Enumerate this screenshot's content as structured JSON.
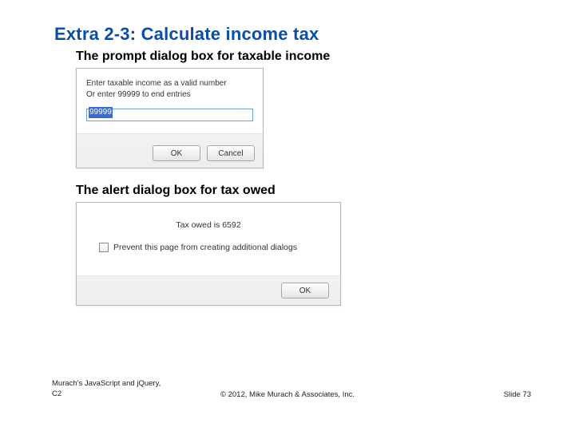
{
  "slide": {
    "title": "Extra 2-3:   Calculate income tax"
  },
  "section1": {
    "heading": "The prompt dialog box for taxable income"
  },
  "prompt": {
    "line1": "Enter taxable income as a valid number",
    "line2": "Or enter 99999 to end entries",
    "input_value": "99999",
    "ok_label": "OK",
    "cancel_label": "Cancel"
  },
  "section2": {
    "heading": "The alert dialog box for tax owed"
  },
  "alert": {
    "message": "Tax owed is 6592",
    "checkbox_label": "Prevent this page from creating additional dialogs",
    "ok_label": "OK"
  },
  "footer": {
    "left_line1": "Murach's JavaScript and jQuery,",
    "left_line2": "C2",
    "center": "© 2012, Mike Murach & Associates, Inc.",
    "right": "Slide 73"
  }
}
